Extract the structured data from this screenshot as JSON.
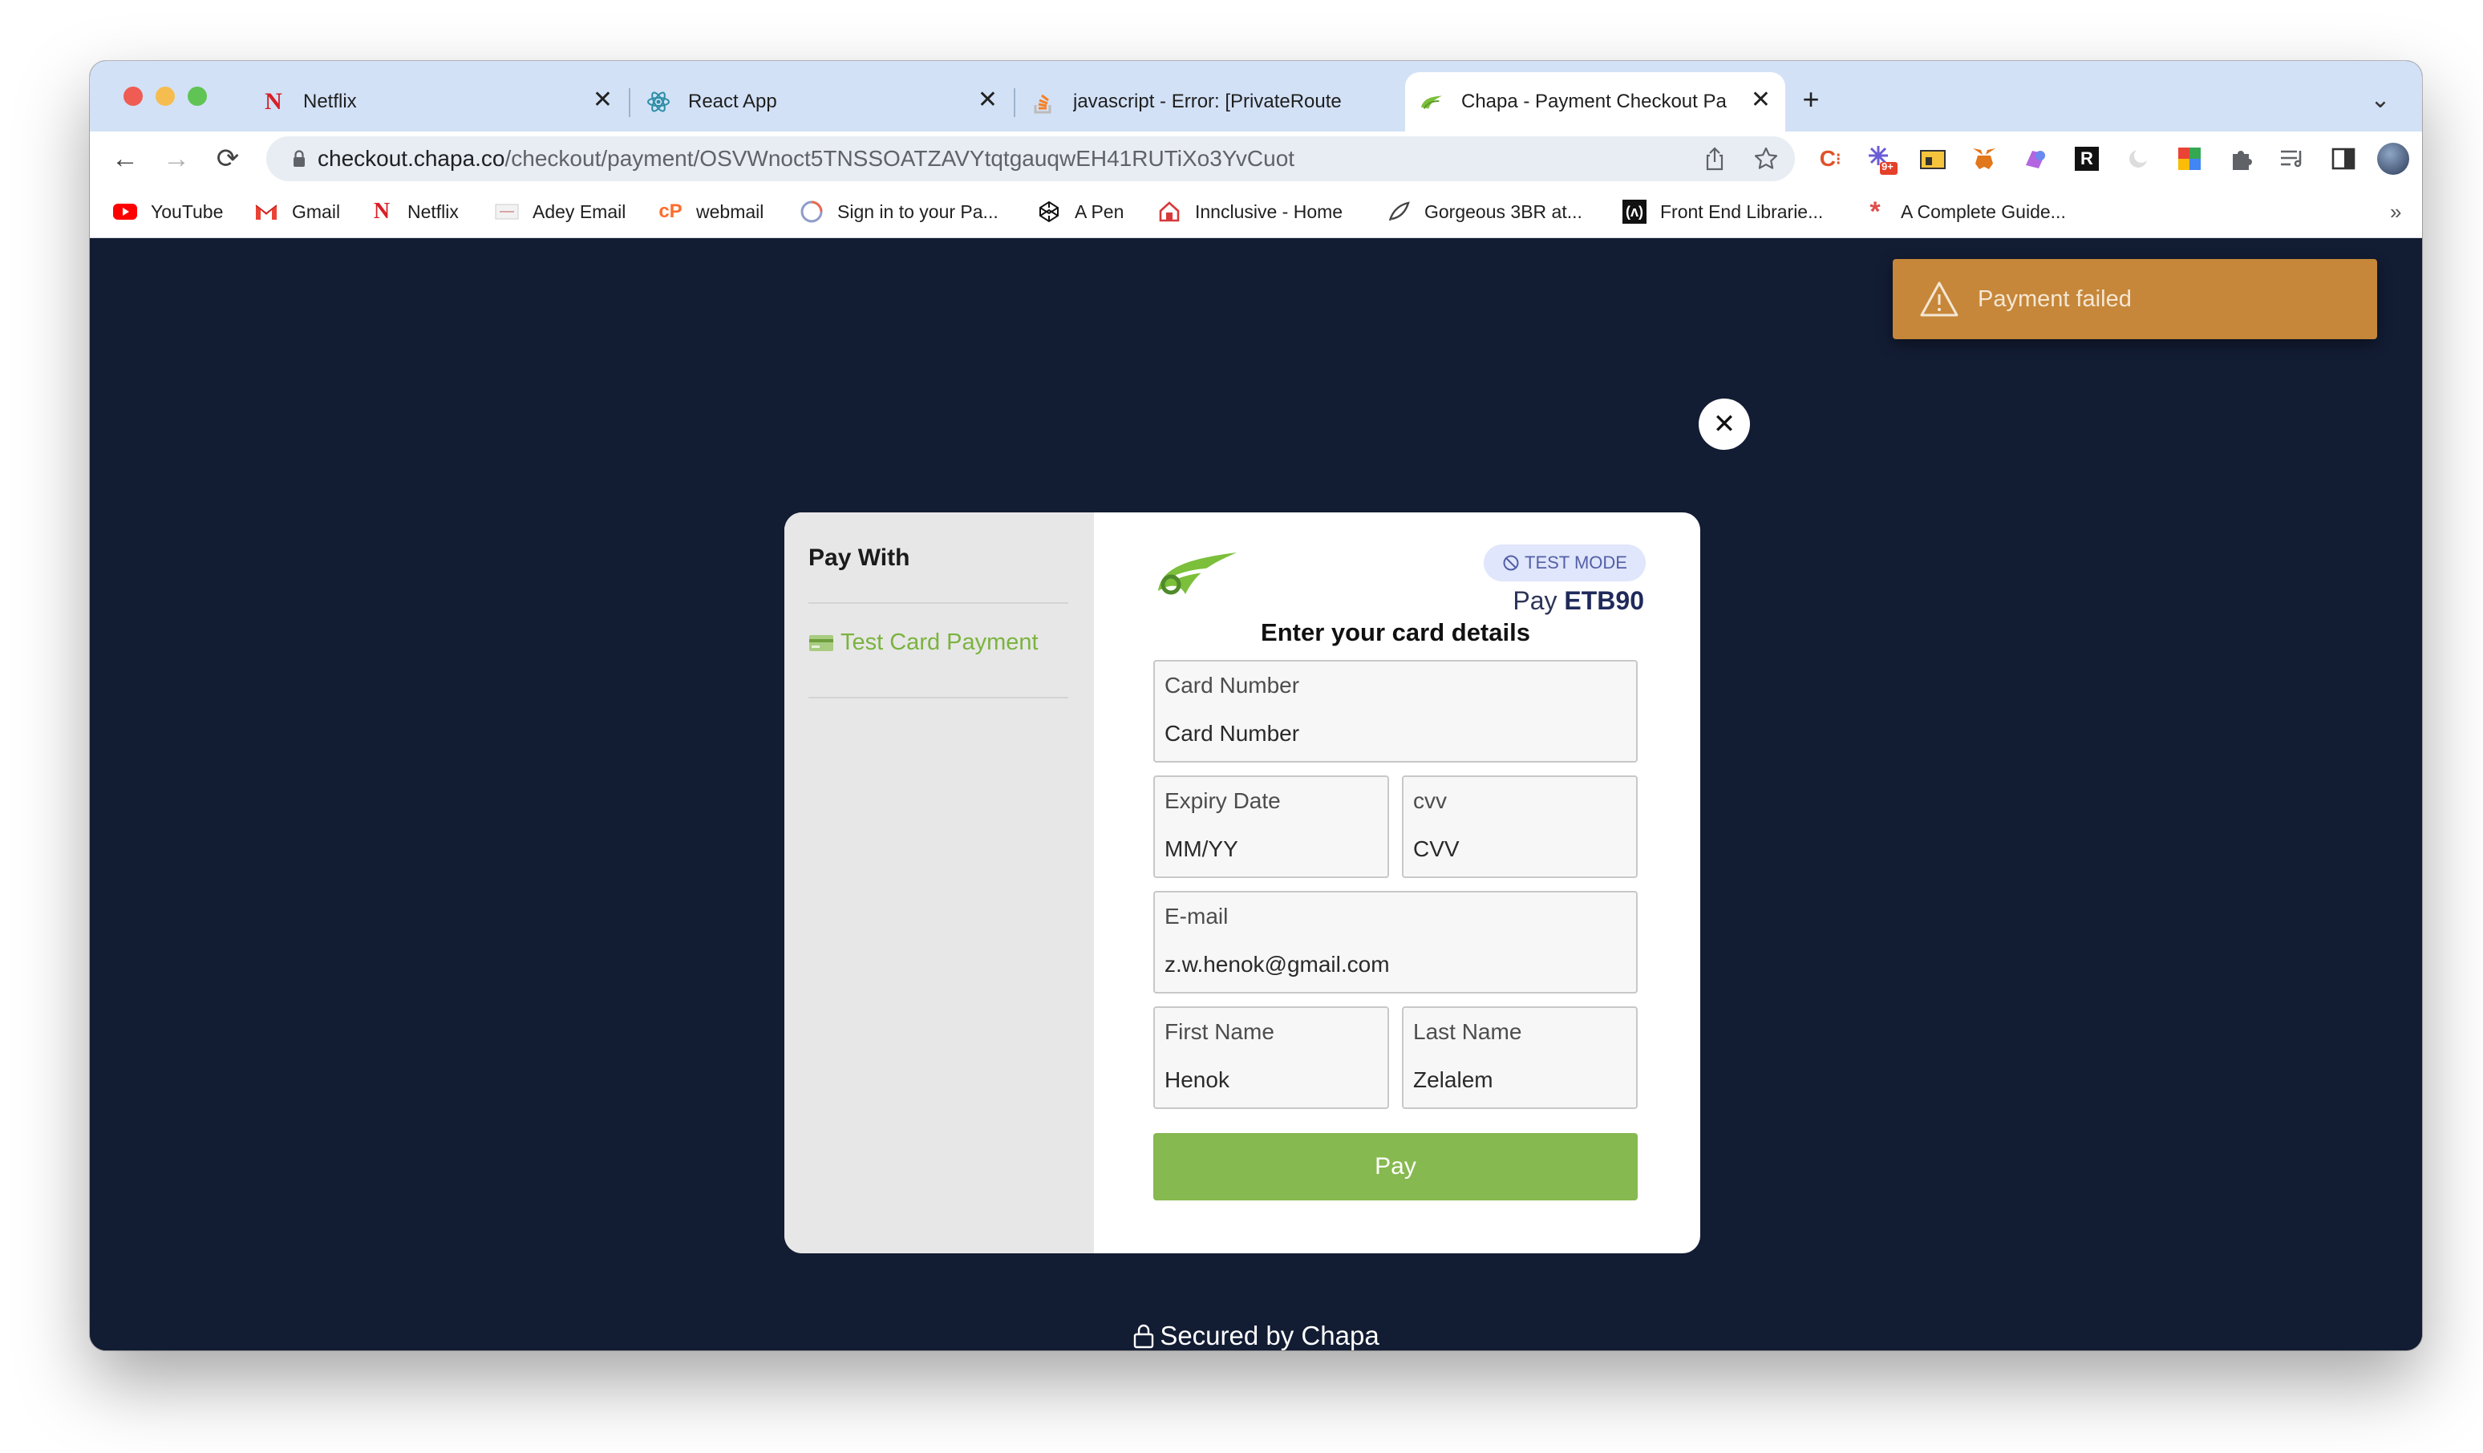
{
  "browser": {
    "tabs": [
      {
        "title": "Netflix",
        "icon": "netflix-icon"
      },
      {
        "title": "React App",
        "icon": "react-icon"
      },
      {
        "title": "javascript - Error: [PrivateRoute",
        "icon": "stackoverflow-icon"
      },
      {
        "title": "Chapa - Payment Checkout Pa",
        "icon": "chapa-icon",
        "active": true
      }
    ],
    "new_tab": "+",
    "close_glyph": "✕",
    "tab_menu": "⌄",
    "address": {
      "host": "checkout.chapa.co",
      "path": "/checkout/payment/OSVWnoct5TNSSOATZAVYtqtgauqwEH41RUTiXo3YvCuot"
    },
    "nav": {
      "back": "←",
      "forward": "→",
      "reload": "⟳"
    },
    "extension_badge": "9+",
    "bookmarks": [
      {
        "label": "YouTube",
        "icon": "youtube-icon"
      },
      {
        "label": "Gmail",
        "icon": "gmail-icon"
      },
      {
        "label": "Netflix",
        "icon": "netflix-icon"
      },
      {
        "label": "Adey Email",
        "icon": "mail-icon"
      },
      {
        "label": "webmail",
        "icon": "cpanel-icon"
      },
      {
        "label": "Sign in to your Pa...",
        "icon": "circle-icon"
      },
      {
        "label": "A Pen",
        "icon": "codepen-icon"
      },
      {
        "label": "Innclusive - Home",
        "icon": "house-icon"
      },
      {
        "label": "Gorgeous 3BR at...",
        "icon": "leaf-icon"
      },
      {
        "label": "Front End Librarie...",
        "icon": "frontend-icon"
      },
      {
        "label": "A Complete Guide...",
        "icon": "asterisk-icon"
      }
    ],
    "bookmarks_overflow": "»"
  },
  "colors": {
    "page_bg": "#121c33",
    "toast_bg": "#c6873a",
    "accent_green": "#86b94f",
    "badge_bg": "#e0e6fb",
    "tab_strip": "#d2e1f6"
  },
  "toast": {
    "message": "Payment failed",
    "icon": "warning-icon"
  },
  "modal": {
    "close": "✕",
    "sidebar": {
      "title": "Pay With",
      "option": "Test Card Payment"
    },
    "badge": "TEST MODE",
    "pay_prefix": "Pay",
    "amount": "ETB90",
    "form_title": "Enter your card details",
    "fields": {
      "card_number": {
        "label": "Card Number",
        "placeholder": "Card Number"
      },
      "expiry": {
        "label": "Expiry Date",
        "placeholder": "MM/YY"
      },
      "cvv": {
        "label": "cvv",
        "placeholder": "CVV"
      },
      "email": {
        "label": "E-mail",
        "value": "z.w.henok@gmail.com"
      },
      "first_name": {
        "label": "First Name",
        "value": "Henok"
      },
      "last_name": {
        "label": "Last Name",
        "value": "Zelalem"
      }
    },
    "pay_button": "Pay"
  },
  "footer": {
    "prefix": "Secured by",
    "brand": "Chapa"
  }
}
